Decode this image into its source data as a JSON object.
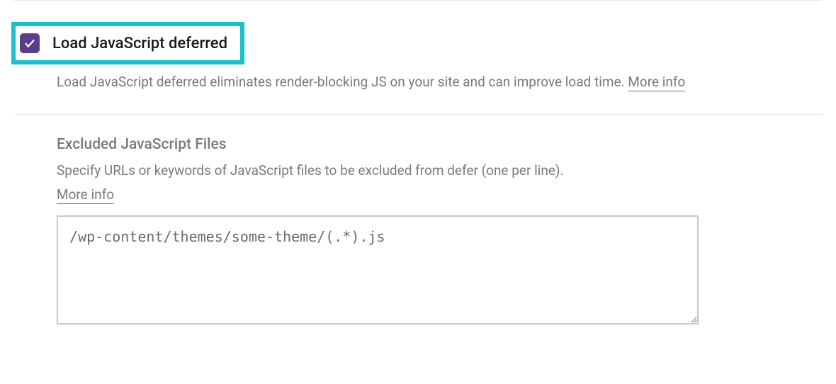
{
  "section1": {
    "checkbox_label": "Load JavaScript deferred",
    "checkbox_checked": true,
    "description": "Load JavaScript deferred eliminates render-blocking JS on your site and can improve load time. ",
    "more_info": "More info"
  },
  "section2": {
    "title": "Excluded JavaScript Files",
    "description": "Specify URLs or keywords of JavaScript files to be excluded from defer (one per line).",
    "more_info": "More info",
    "textarea_value": "/wp-content/themes/some-theme/(.*).js"
  },
  "colors": {
    "highlight_border": "#1bc0cb",
    "checkbox_bg": "#5b3d8c",
    "text_muted": "#7a7a7a"
  }
}
